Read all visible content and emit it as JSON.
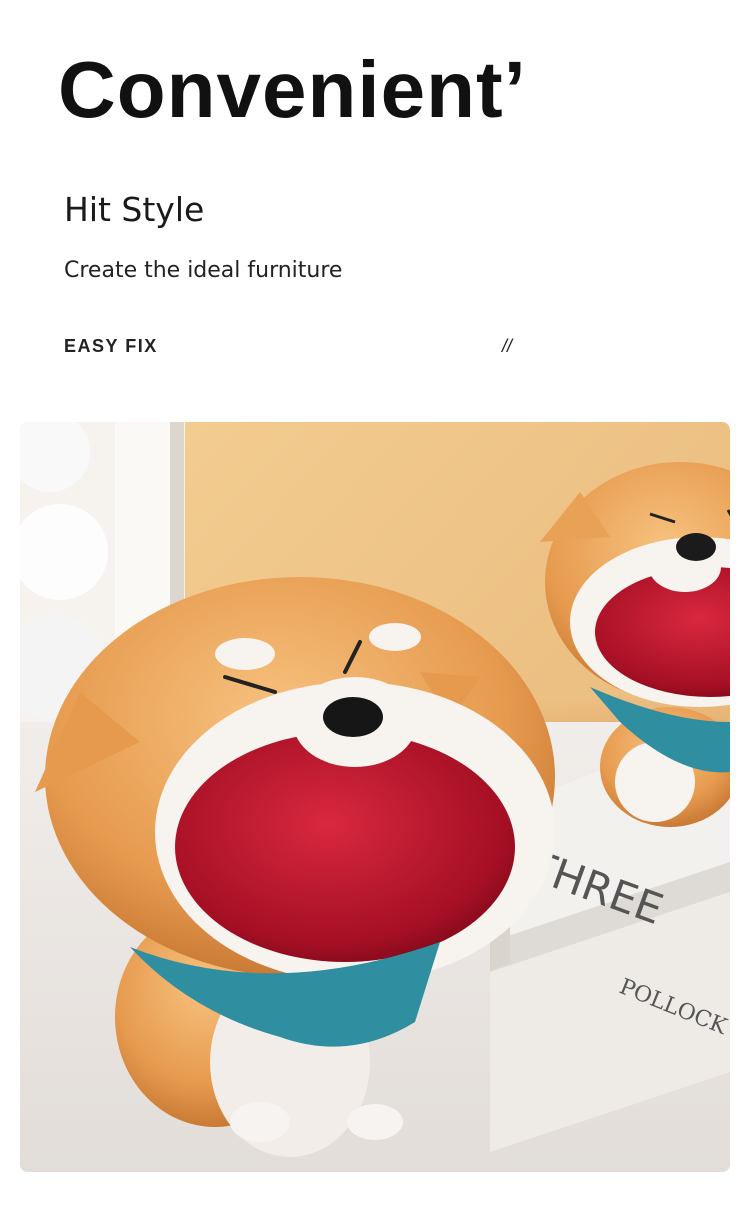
{
  "headline": "Convenient’",
  "subhead": "Hit Style",
  "tagline": "Create the ideal furniture",
  "feature_label": "EASY FIX",
  "divider_mark": "//",
  "photo": {
    "book_title": "THREE",
    "book_author": "POLLOCK",
    "colors": {
      "wall": "#efc78c",
      "table": "#efebe7",
      "fur": "#e9a155",
      "mouth": "#b8122a",
      "bandana": "#2f8ea0"
    }
  }
}
